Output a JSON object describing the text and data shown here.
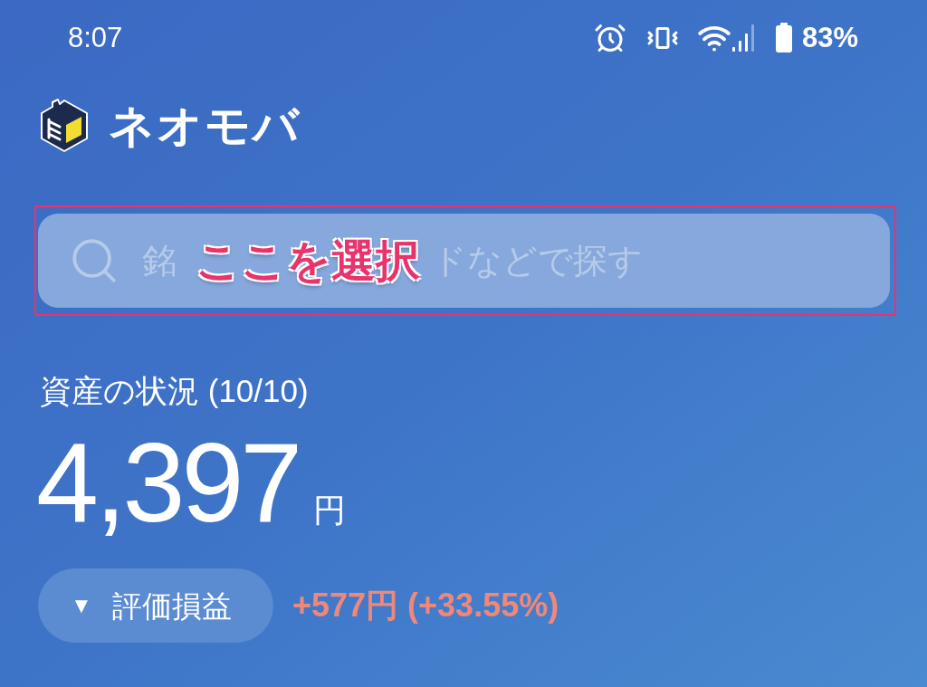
{
  "status_bar": {
    "time": "8:07",
    "battery": "83%"
  },
  "header": {
    "app_name": "ネオモバ"
  },
  "search": {
    "placeholder_visible": [
      "銘",
      "ドなどで探す"
    ]
  },
  "annotation": {
    "label": "ここを選択"
  },
  "assets": {
    "title": "資産の状況 (10/10)",
    "amount": "4,397",
    "unit": "円"
  },
  "profit": {
    "toggle_icon": "▼",
    "toggle_label": "評価損益",
    "value": "+577円 (+33.55%)"
  }
}
